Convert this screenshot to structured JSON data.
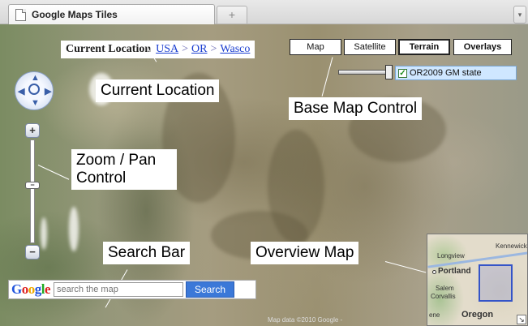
{
  "browser": {
    "tab_title": "Google Maps Tiles",
    "new_tab_label": "+",
    "tab_menu_label": "▾"
  },
  "breadcrumb": {
    "label": "Current Location",
    "items": [
      "USA",
      "OR",
      "Wasco"
    ],
    "separator": ">"
  },
  "map_types": {
    "map": "Map",
    "satellite": "Satellite",
    "terrain": "Terrain",
    "overlays": "Overlays",
    "active": "Terrain"
  },
  "overlay": {
    "layer_label": "OR2009 GM state",
    "checked": true,
    "opacity_fraction": 0.9
  },
  "zoom": {
    "in_label": "+",
    "out_label": "−",
    "level_fraction": 0.4
  },
  "annotations": {
    "current_location": "Current Location",
    "base_map_control": "Base Map Control",
    "zoom_pan_control": "Zoom / Pan Control",
    "search_bar": "Search Bar",
    "overview_map": "Overview Map"
  },
  "search": {
    "placeholder": "search the map",
    "button_label": "Search",
    "logo_letters": [
      "G",
      "o",
      "o",
      "g",
      "l",
      "e"
    ]
  },
  "copyright": "Map data ©2010 Google -",
  "overview": {
    "labels": {
      "longview": "Longview",
      "kennewick": "Kennewick",
      "portland": "Portland",
      "salem": "Salem",
      "corvallis": "Corvallis",
      "oregon": "Oregon",
      "ene": "ene"
    },
    "collapse_label": "↘"
  },
  "colors": {
    "link": "#1a3ed0",
    "search_button": "#3b78d8",
    "overlay_bg": "#cfe7ff",
    "overview_rect": "#3454c8"
  }
}
